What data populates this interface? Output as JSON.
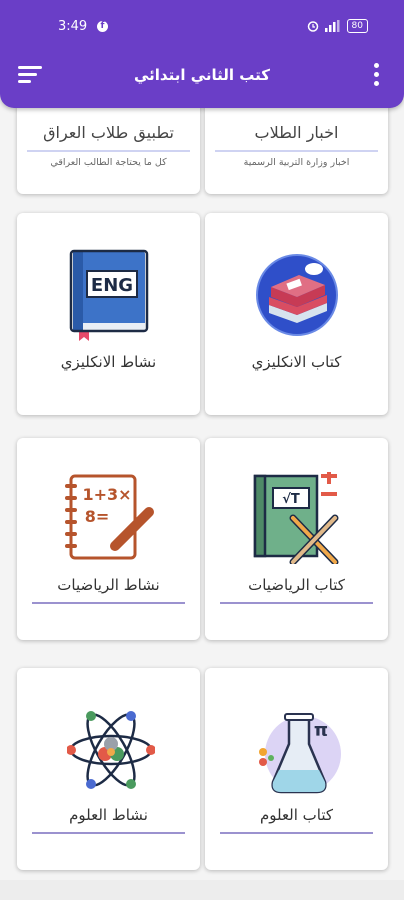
{
  "status_bar": {
    "time": "3:49",
    "fb_icon_letter": "f",
    "battery": "80"
  },
  "app_bar": {
    "title": "كتب الثاني ابتدائي"
  },
  "top_cards": [
    {
      "title": "اخبار الطلاب",
      "subtitle": "اخبار وزارة التربية الرسمية"
    },
    {
      "title": "تطبيق طلاب العراق",
      "subtitle": "كل ما يحتاجة الطالب العراقي"
    }
  ],
  "grid": [
    {
      "label": "كتاب الانكليزي",
      "icon": "english-book-icon"
    },
    {
      "label": "نشاط الانكليزي",
      "icon": "eng-notebook-icon",
      "icon_text": "ENG"
    },
    {
      "label": "كتاب الرياضيات",
      "icon": "math-book-icon",
      "icon_text": "√T"
    },
    {
      "label": "نشاط الرياضيات",
      "icon": "math-notebook-icon",
      "icon_text": "1+3×",
      "icon_text2": "8="
    },
    {
      "label": "كتاب العلوم",
      "icon": "flask-icon",
      "icon_text": "π"
    },
    {
      "label": "نشاط العلوم",
      "icon": "atom-icon"
    }
  ],
  "colors": {
    "primary": "#6a3ec7",
    "underline": "#9b92cf",
    "top_underline": "#cfd3f2"
  }
}
